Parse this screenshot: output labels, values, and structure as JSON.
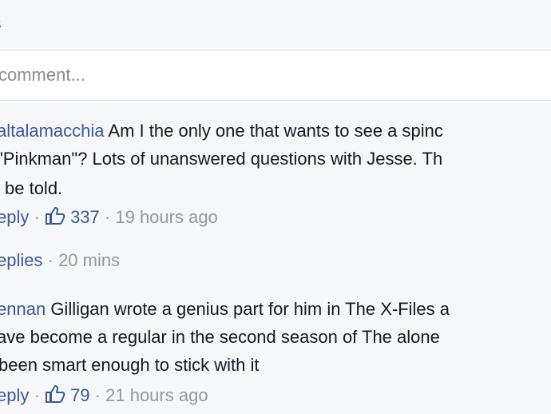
{
  "top_link": "s",
  "comment_input": {
    "placeholder": "comment..."
  },
  "comments": [
    {
      "author": "altalamacchia",
      "lines": [
        "Am I the only one that wants to see a spinc",
        "\"Pinkman\"? Lots of unanswered questions with Jesse. Th",
        "be told."
      ],
      "reply_label": "eply",
      "likes": "337",
      "time": "19 hours ago"
    },
    {
      "replies_label": "eplies",
      "replies_time": "20 mins"
    },
    {
      "author": "ennan",
      "lines": [
        "Gilligan wrote a genius part for him in The X-Files a",
        "ave become a regular in the second season of The alone",
        "been smart enough to stick with it"
      ],
      "reply_label": "eply",
      "likes": "79",
      "time": "21 hours ago"
    }
  ],
  "separator": "·",
  "colors": {
    "link": "#3b5998",
    "text": "#141823",
    "meta": "#9197a3",
    "background": "#f6f7f8"
  },
  "icons": {
    "like": "thumbs-up-icon"
  }
}
